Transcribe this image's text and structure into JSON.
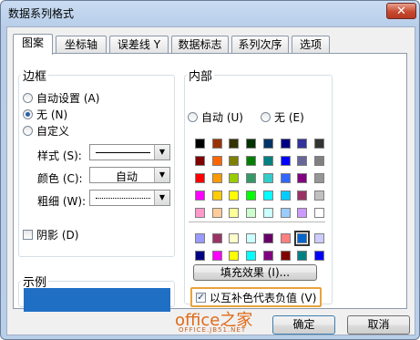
{
  "window": {
    "title": "数据系列格式",
    "close_glyph": "✕"
  },
  "tabs": [
    {
      "label": "图案"
    },
    {
      "label": "坐标轴"
    },
    {
      "label": "误差线 Y"
    },
    {
      "label": "数据标志"
    },
    {
      "label": "系列次序"
    },
    {
      "label": "选项"
    }
  ],
  "border": {
    "heading": "边框",
    "auto": "自动设置 (A)",
    "none": "无 (N)",
    "custom": "自定义",
    "selected": "none",
    "style_label": "样式 (S):",
    "color_label": "颜色 (C):",
    "color_value": "自动",
    "weight_label": "粗细 (W):"
  },
  "shadow": {
    "label": "阴影 (D)",
    "checked": false
  },
  "sample": {
    "heading": "示例",
    "color": "#1f6fc5"
  },
  "area": {
    "heading": "内部",
    "auto": "自动 (U)",
    "none": "无 (E)",
    "palette": [
      [
        "#000000",
        "#993300",
        "#333300",
        "#003300",
        "#003366",
        "#000080",
        "#333399",
        "#333333"
      ],
      [
        "#800000",
        "#ff6600",
        "#808000",
        "#008000",
        "#008080",
        "#0000ff",
        "#666699",
        "#808080"
      ],
      [
        "#ff0000",
        "#ff9900",
        "#99cc00",
        "#339966",
        "#33cccc",
        "#3366ff",
        "#800080",
        "#969696"
      ],
      [
        "#ff00ff",
        "#ffcc00",
        "#ffff00",
        "#00ff00",
        "#00ffff",
        "#00ccff",
        "#993366",
        "#c0c0c0"
      ],
      [
        "#ff99cc",
        "#ffcc99",
        "#ffff99",
        "#ccffcc",
        "#ccffff",
        "#99ccff",
        "#cc99ff",
        "#ffffff"
      ]
    ],
    "extra": [
      [
        "#9999ff",
        "#993366",
        "#ffffcc",
        "#ccffff",
        "#660066",
        "#ff8080",
        "#0066cc",
        "#ccccff"
      ],
      [
        "#000080",
        "#ff00ff",
        "#ffff00",
        "#00ffff",
        "#800080",
        "#800000",
        "#008080",
        "#0000ff"
      ]
    ],
    "fill_effects": "填充效果 (I)...",
    "invert_label": "以互补色代表负值 (V)",
    "invert_checked": true
  },
  "footer": {
    "watermark_main": "office之家",
    "watermark_sub": "OFFICE.JB51.NET",
    "ok": "确定",
    "cancel": "取消"
  }
}
